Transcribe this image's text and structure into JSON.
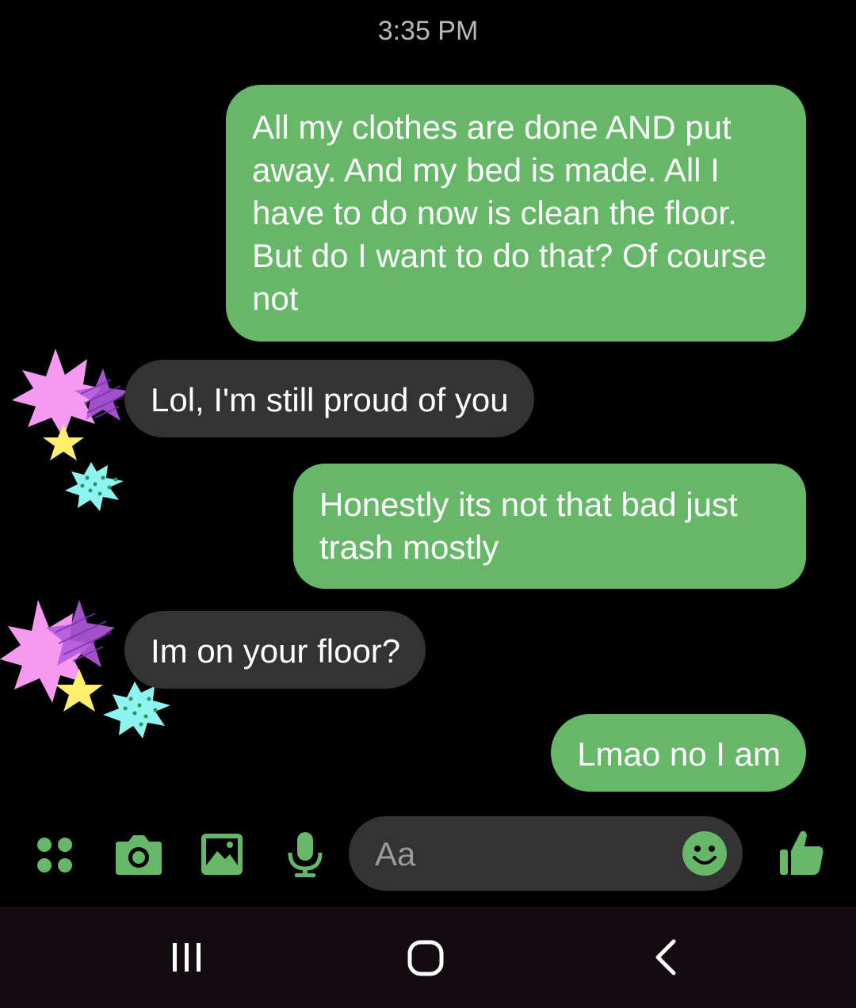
{
  "status": {
    "time": "3:35 PM"
  },
  "messages": [
    {
      "direction": "sent",
      "text": "All my clothes are done AND put away. And my bed is made. All I have to do now is clean the floor. But do I want to do that? Of course not"
    },
    {
      "direction": "received",
      "text": "Lol, I'm still proud of you"
    },
    {
      "direction": "sent",
      "text": "Honestly its not that bad just trash mostly"
    },
    {
      "direction": "received",
      "text": "Im on your floor?"
    },
    {
      "direction": "sent",
      "text": "Lmao no I am"
    }
  ],
  "composer": {
    "placeholder": "Aa",
    "icons": [
      "apps-grid-icon",
      "camera-icon",
      "gallery-icon",
      "microphone-icon",
      "emoji-icon",
      "thumbs-up-icon"
    ]
  },
  "navbar": {
    "icons": [
      "recent-apps-icon",
      "home-icon",
      "back-icon"
    ]
  },
  "colors": {
    "accent": "#66b868",
    "sent_bubble": "#66b868",
    "received_bubble": "#333333",
    "background": "#000000",
    "sticker_pink": "#f59af0",
    "sticker_purple": "#b45bde",
    "sticker_yellow": "#ffef6a",
    "sticker_cyan": "#8ff3ee"
  }
}
